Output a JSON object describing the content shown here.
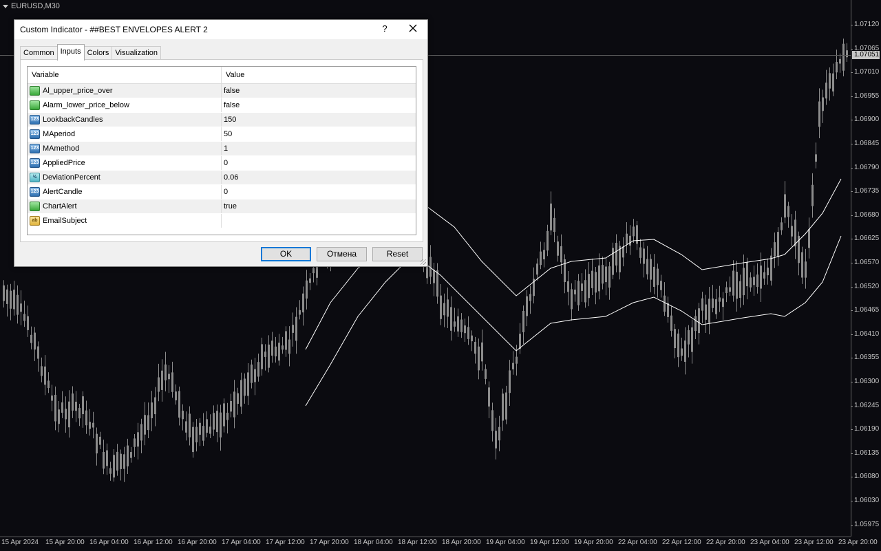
{
  "chart": {
    "symbol": "EURUSD,M30",
    "current_price": "1.07051",
    "price_ticks": [
      "1.07120",
      "1.07065",
      "1.07010",
      "1.06955",
      "1.06900",
      "1.06845",
      "1.06790",
      "1.06735",
      "1.06680",
      "1.06625",
      "1.06570",
      "1.06520",
      "1.06465",
      "1.06410",
      "1.06355",
      "1.06300",
      "1.06245",
      "1.06190",
      "1.06135",
      "1.06080",
      "1.06030",
      "1.05975"
    ],
    "time_ticks": [
      "15 Apr 2024",
      "15 Apr 20:00",
      "16 Apr 04:00",
      "16 Apr 12:00",
      "16 Apr 20:00",
      "17 Apr 04:00",
      "17 Apr 12:00",
      "17 Apr 20:00",
      "18 Apr 04:00",
      "18 Apr 12:00",
      "18 Apr 20:00",
      "19 Apr 04:00",
      "19 Apr 12:00",
      "19 Apr 20:00",
      "22 Apr 04:00",
      "22 Apr 12:00",
      "22 Apr 20:00",
      "23 Apr 04:00",
      "23 Apr 12:00",
      "23 Apr 20:00"
    ],
    "colors": {
      "background": "#0b0b10",
      "candles": "#8c8c8c",
      "envelope": "#ffffff",
      "axis_text": "#c8c8c8"
    }
  },
  "dialog": {
    "title": "Custom Indicator - ##BEST ENVELOPES ALERT 2",
    "help_label": "?",
    "tabs": [
      {
        "label": "Common"
      },
      {
        "label": "Inputs"
      },
      {
        "label": "Colors"
      },
      {
        "label": "Visualization"
      }
    ],
    "active_tab": "Inputs",
    "columns": {
      "variable": "Variable",
      "value": "Value"
    },
    "params": [
      {
        "icon": "bool-type-icon",
        "icon_text": "",
        "name": "Al_upper_price_over",
        "value": "false"
      },
      {
        "icon": "bool-type-icon",
        "icon_text": "",
        "name": "Alarm_lower_price_below",
        "value": "false"
      },
      {
        "icon": "int-type-icon",
        "icon_text": "123",
        "name": "LookbackCandles",
        "value": "150"
      },
      {
        "icon": "int-type-icon",
        "icon_text": "123",
        "name": "MAperiod",
        "value": "50"
      },
      {
        "icon": "int-type-icon",
        "icon_text": "123",
        "name": "MAmethod",
        "value": "1"
      },
      {
        "icon": "int-type-icon",
        "icon_text": "123",
        "name": "AppliedPrice",
        "value": "0"
      },
      {
        "icon": "double-type-icon",
        "icon_text": "½",
        "name": "DeviationPercent",
        "value": "0.06"
      },
      {
        "icon": "int-type-icon",
        "icon_text": "123",
        "name": "AlertCandle",
        "value": "0"
      },
      {
        "icon": "bool-type-icon",
        "icon_text": "",
        "name": "ChartAlert",
        "value": "true"
      },
      {
        "icon": "string-type-icon",
        "icon_text": "ab",
        "name": "EmailSubject",
        "value": ""
      }
    ],
    "buttons": {
      "ok": "OK",
      "cancel": "Отмена",
      "reset": "Reset"
    }
  }
}
